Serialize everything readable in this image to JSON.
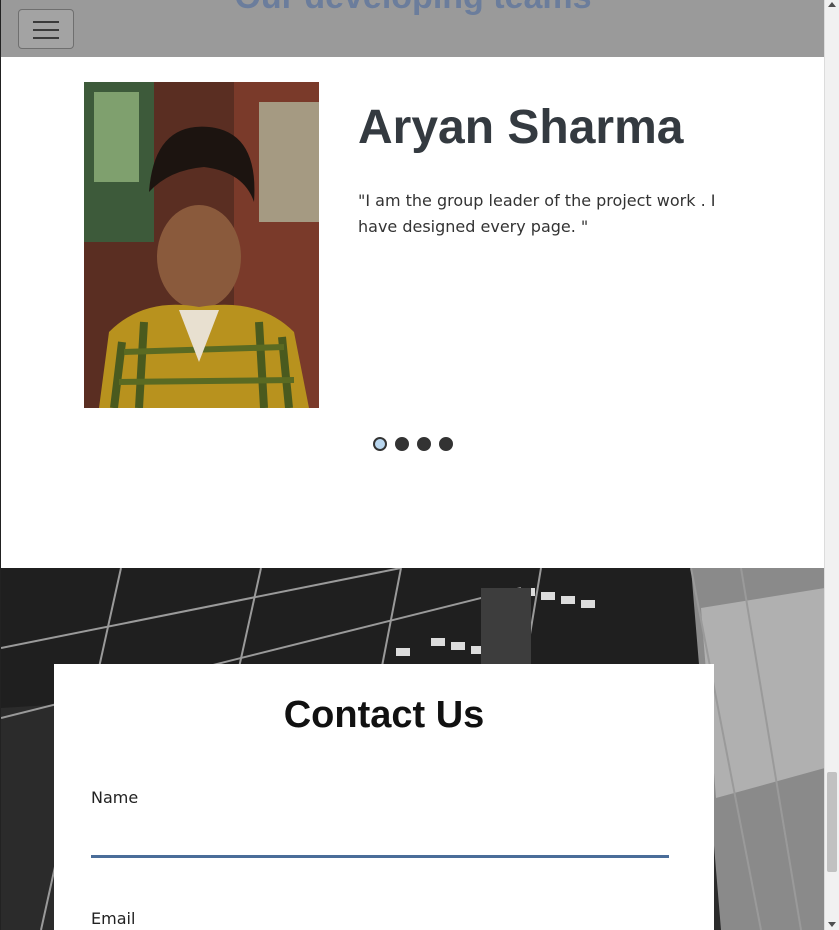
{
  "header": {
    "section_title": "Our developing teams",
    "menu_icon": "hamburger-menu-icon"
  },
  "team": {
    "active_index": 0,
    "members": [
      {
        "name": "Aryan Sharma",
        "quote": "\"I am the group leader of the project work . I have designed every page. \""
      }
    ],
    "indicator_count": 4
  },
  "contact": {
    "title": "Contact Us",
    "name_label": "Name",
    "name_value": "",
    "email_label": "Email",
    "email_value": ""
  },
  "colors": {
    "navbar": "#9a9a9a",
    "heading": "#343a40",
    "input_underline": "#4a6d99",
    "active_indicator": "#b9d6ee"
  }
}
